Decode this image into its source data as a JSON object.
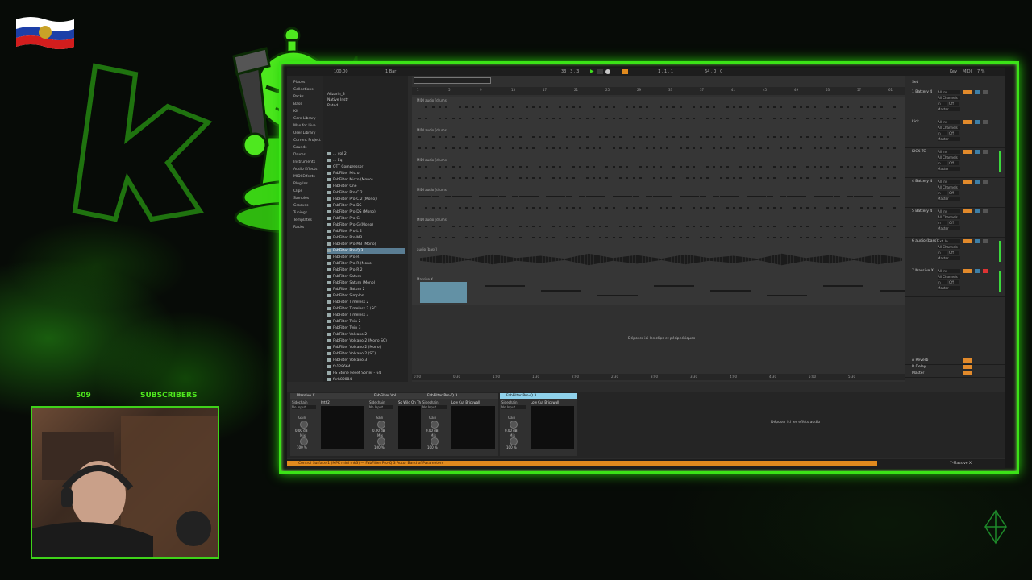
{
  "overlay": {
    "subscriber_count": "509",
    "subscribers_label": "SUBSCRIBERS"
  },
  "toolbar": {
    "tempo": "100.00",
    "bar": "1 Bar",
    "position": "33 . 3 . 3",
    "loop_start": "1 . 1 . 1",
    "zoom": "64 . 0 . 0",
    "key": "Key",
    "midi": "MIDI",
    "cpu": "7 %"
  },
  "browser": {
    "side_items": [
      "Places",
      "Collections",
      "Packs",
      "Bass",
      "Kit",
      "Core Library",
      "Max for Live",
      "User Library",
      "Current Project",
      "Sounds",
      "Drums",
      "Instruments",
      "Audio Effects",
      "MIDI Effects",
      "Plug-Ins",
      "Clips",
      "Samples",
      "Grooves",
      "Tunings",
      "Templates",
      "Racks"
    ],
    "top_items": [
      "Alizarin_3",
      "Native Instr",
      "Rated"
    ],
    "items": [
      "... vol 2",
      "... Eq",
      "OTT Compressor",
      "FabFilter Micro",
      "FabFilter Micro (Mono)",
      "FabFilter One",
      "FabFilter Pro-C 2",
      "FabFilter Pro-C 2 (Mono)",
      "FabFilter Pro-DS",
      "FabFilter Pro-DS (Mono)",
      "FabFilter Pro-G",
      "FabFilter Pro-G (Mono)",
      "FabFilter Pro-L 2",
      "FabFilter Pro-MB",
      "FabFilter Pro-MB (Mono)",
      "FabFilter Pro-Q 3",
      "FabFilter Pro-R",
      "FabFilter Pro-R (Mono)",
      "FabFilter Pro-R 2",
      "FabFilter Saturn",
      "FabFilter Saturn (Mono)",
      "FabFilter Saturn 2",
      "FabFilter Simplon",
      "FabFilter Timeless 2",
      "FabFilter Timeless 2 (SC)",
      "FabFilter Timeless 3",
      "FabFilter Twin 2",
      "FabFilter Twin 3",
      "FabFilter Volcano 2",
      "FabFilter Volcano 2 (Mono SC)",
      "FabFilter Volcano 2 (Mono)",
      "FabFilter Volcano 2 (SC)",
      "FabFilter Volcano 3",
      "fb128664",
      "FS Stone Reset Sorter - 64",
      "fxrb80084"
    ],
    "selected_index": 15
  },
  "ruler": [
    "1",
    "5",
    "9",
    "13",
    "17",
    "21",
    "25",
    "29",
    "33",
    "37",
    "41",
    "45",
    "49",
    "53",
    "57",
    "61"
  ],
  "time_ruler": [
    "0:00",
    "0:30",
    "1:00",
    "1:30",
    "2:00",
    "2:30",
    "3:00",
    "3:30",
    "4:00",
    "4:30",
    "5:00",
    "5:30"
  ],
  "tracks": [
    {
      "clip": "MIDI audio [drums]",
      "type": "midi"
    },
    {
      "clip": "MIDI audio [drums]",
      "type": "midi"
    },
    {
      "clip": "MIDI audio [drums]",
      "type": "midi"
    },
    {
      "clip": "MIDI audio [drums]",
      "type": "midi"
    },
    {
      "clip": "MIDI audio [drums]",
      "type": "midi"
    },
    {
      "clip": "audio [bass]",
      "type": "audio"
    },
    {
      "clip": "Massive X",
      "type": "midi2"
    }
  ],
  "arrangement_drop": "Déposer ici les clips et périphériques",
  "mixer": {
    "set_label": "Set",
    "tracks": [
      {
        "name": "1 Battery 4",
        "input": "All Ins",
        "num": "1"
      },
      {
        "name": "kick",
        "input": "All Ins",
        "num": "2"
      },
      {
        "name": "KICK TC",
        "input": "All Ins",
        "num": "3"
      },
      {
        "name": "4 Battery 4",
        "input": "All Ins",
        "num": "4"
      },
      {
        "name": "5 Battery 4",
        "input": "All Ins",
        "num": "5"
      },
      {
        "name": "6 audio (bass)",
        "input": "Ext. In",
        "num": "6"
      },
      {
        "name": "7 Massive X",
        "input": "All Ins",
        "num": "7"
      }
    ],
    "sub_labels": {
      "channel": "All Channels",
      "in": "In",
      "auto": "Auto",
      "off": "Off",
      "master": "Master"
    },
    "returns": [
      {
        "name": "A Reverb",
        "num": "A"
      },
      {
        "name": "B Delay",
        "num": "B"
      },
      {
        "name": "Master",
        "num": "1/2"
      }
    ]
  },
  "devices": [
    {
      "title": "Massive X",
      "sidechain": "Sidechain",
      "input": "No Input",
      "gain": "Gain",
      "gain_val": "0.00 dB",
      "mix": "Mix",
      "mix_val": "100 %",
      "preset": "hrth2",
      "active": false
    },
    {
      "title": "FabFilter Vol",
      "sidechain": "Sidechain",
      "input": "No Input",
      "gain": "Gain",
      "gain_val": "0.00 dB",
      "mix": "Mix",
      "mix_val": "100 %",
      "preset": "So Wild On The Dance",
      "active": false
    },
    {
      "title": "FabFilter Pro-Q 3",
      "sidechain": "Sidechain",
      "input": "No Input",
      "gain": "Gain",
      "gain_val": "0.00 dB",
      "mix": "Mix",
      "mix_val": "100 %",
      "preset": "Low Cut Brickwall",
      "active": false
    },
    {
      "title": "FabFilter Pro-Q 3",
      "sidechain": "Sidechain",
      "input": "No Input",
      "gain": "Gain",
      "gain_val": "0.00 dB",
      "mix": "Mix",
      "mix_val": "100 %",
      "preset": "Low Cut Brickwall",
      "active": true
    }
  ],
  "device_drop": "Déposer ici les effets audio",
  "status": {
    "message": "Control Surface 1 (MPK mini mk3) — FabFilter Pro-Q 3 Auto: Band of Parameters",
    "device_name": "7-Massive X"
  }
}
